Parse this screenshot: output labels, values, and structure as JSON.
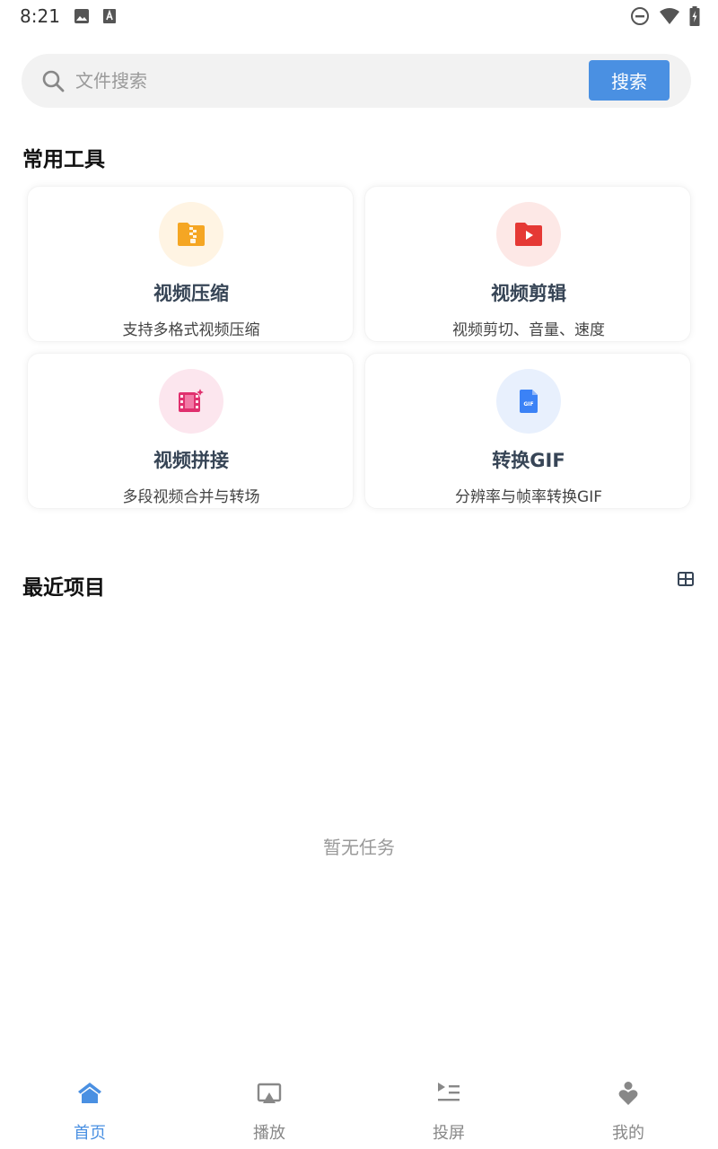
{
  "status_bar": {
    "time": "8:21",
    "left_icons": [
      "image-icon",
      "text-a-icon"
    ],
    "right_icons": [
      "do-not-disturb-icon",
      "wifi-icon",
      "battery-charging-icon"
    ]
  },
  "search": {
    "placeholder": "文件搜索",
    "value": "",
    "button_label": "搜索"
  },
  "tools_section": {
    "title": "常用工具",
    "items": [
      {
        "name": "视频压缩",
        "desc": "支持多格式视频压缩",
        "icon": "zip-folder-icon",
        "icon_color": "#f5a623",
        "bg_color": "#fff4e3"
      },
      {
        "name": "视频剪辑",
        "desc": "视频剪切、音量、速度",
        "icon": "video-folder-icon",
        "icon_color": "#e53935",
        "bg_color": "#fde8e6"
      },
      {
        "name": "视频拼接",
        "desc": "多段视频合并与转场",
        "icon": "film-sparkle-icon",
        "icon_color": "#e0306e",
        "bg_color": "#fce6ee"
      },
      {
        "name": "转换GIF",
        "desc": "分辨率与帧率转换GIF",
        "icon": "gif-file-icon",
        "icon_color": "#3b82f6",
        "bg_color": "#e8f0fd"
      }
    ]
  },
  "recent_section": {
    "title": "最近项目",
    "empty_text": "暂无任务"
  },
  "bottom_nav": {
    "items": [
      {
        "label": "首页",
        "icon": "home-icon",
        "active": true
      },
      {
        "label": "播放",
        "icon": "cast-screen-icon",
        "active": false
      },
      {
        "label": "投屏",
        "icon": "playlist-icon",
        "active": false
      },
      {
        "label": "我的",
        "icon": "user-heart-icon",
        "active": false
      }
    ]
  },
  "colors": {
    "accent": "#4a90e2",
    "inactive_nav": "#888888"
  }
}
